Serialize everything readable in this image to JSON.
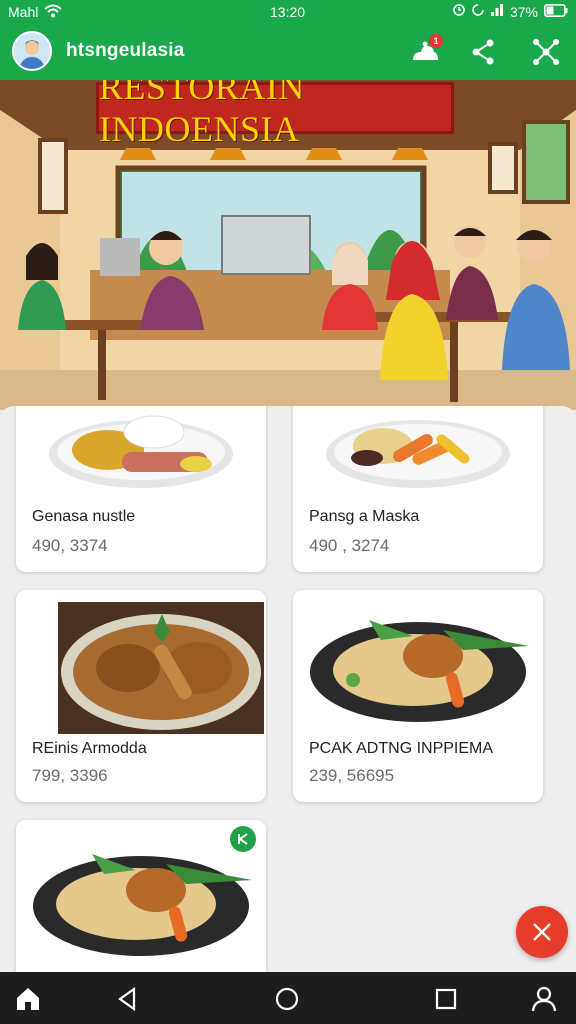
{
  "status_bar": {
    "carrier": "Mahl",
    "time": "13:20",
    "battery": "37%"
  },
  "app_bar": {
    "title": "htsngeulasia",
    "notification_count": "1",
    "actions": [
      "notifications-icon",
      "share-icon",
      "network-icon"
    ]
  },
  "hero": {
    "banner_text": "RESTORAIN INDOENSIA"
  },
  "dishes": [
    {
      "name": "Genasa nustle",
      "price": "490, 3374"
    },
    {
      "name": "Pansg a Maska",
      "price": "490 , 3274"
    },
    {
      "name": "REinis Armodda",
      "price": "799, 3396"
    },
    {
      "name": "PCAK ADTNG INPPIEMA",
      "price": "239, 56695"
    },
    {
      "name": "",
      "price": ""
    }
  ],
  "fab": {
    "icon": "close-icon",
    "color": "#e53c2b"
  },
  "nav_bar": {
    "items": [
      "home-icon",
      "back-icon",
      "circle-home-icon",
      "recents-icon",
      "profile-icon"
    ]
  },
  "colors": {
    "primary": "#19a84a",
    "accent": "#e53c2b"
  }
}
